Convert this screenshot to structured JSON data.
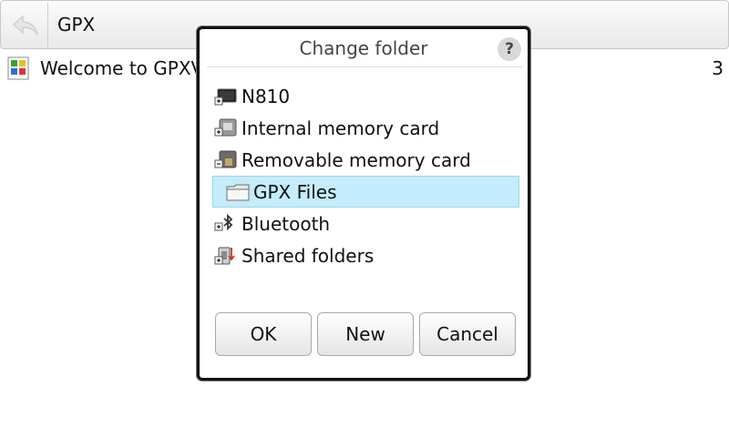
{
  "topbar": {
    "title": "GPX",
    "back_icon": "back-arrow-icon"
  },
  "background_list": [
    {
      "label": "Welcome to GPXVi",
      "count": "3",
      "icon": "gpx-file-icon"
    }
  ],
  "dialog": {
    "title": "Change folder",
    "help_label": "?",
    "items": [
      {
        "label": "N810",
        "icon": "device-icon",
        "selected": false
      },
      {
        "label": "Internal memory card",
        "icon": "memory-card-icon",
        "selected": false
      },
      {
        "label": "Removable memory card",
        "icon": "removable-card-icon",
        "selected": false
      },
      {
        "label": "GPX Files",
        "icon": "folder-icon",
        "selected": true
      },
      {
        "label": "Bluetooth",
        "icon": "bluetooth-icon",
        "selected": false
      },
      {
        "label": "Shared folders",
        "icon": "shared-folder-icon",
        "selected": false
      }
    ],
    "buttons": {
      "ok": "OK",
      "new": "New",
      "cancel": "Cancel"
    }
  },
  "colors": {
    "selection": "#c4ecfa",
    "dialog_border": "#111111"
  }
}
